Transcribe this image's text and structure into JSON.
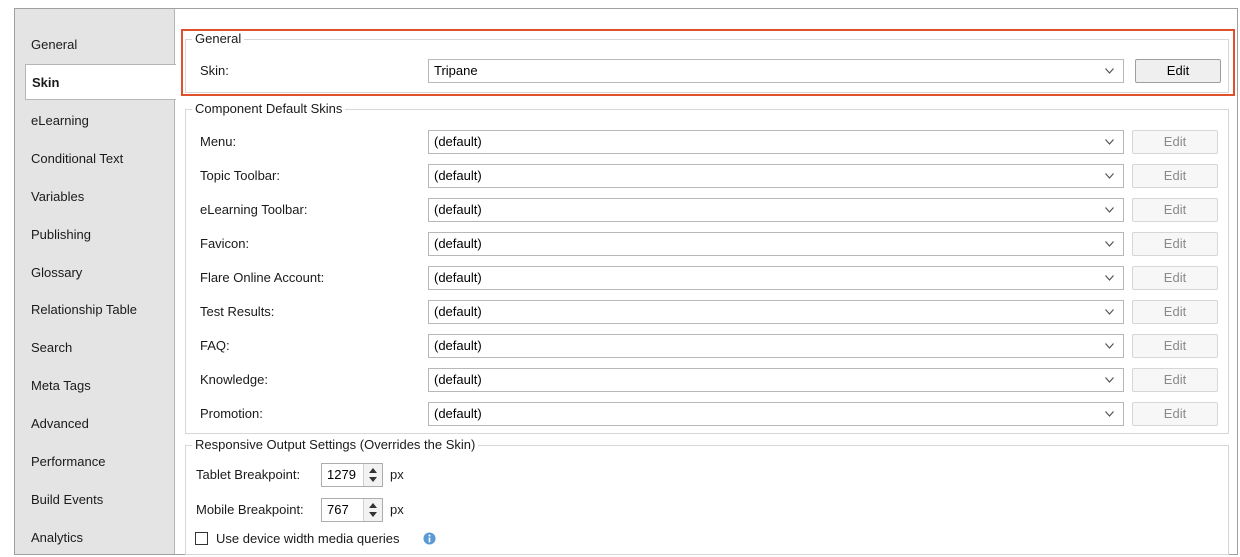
{
  "sidebar": {
    "items": [
      {
        "label": "General",
        "active": false
      },
      {
        "label": "Skin",
        "active": true
      },
      {
        "label": "eLearning",
        "active": false
      },
      {
        "label": "Conditional Text",
        "active": false
      },
      {
        "label": "Variables",
        "active": false
      },
      {
        "label": "Publishing",
        "active": false
      },
      {
        "label": "Glossary",
        "active": false
      },
      {
        "label": "Relationship Table",
        "active": false
      },
      {
        "label": "Search",
        "active": false
      },
      {
        "label": "Meta Tags",
        "active": false
      },
      {
        "label": "Advanced",
        "active": false
      },
      {
        "label": "Performance",
        "active": false
      },
      {
        "label": "Build Events",
        "active": false
      },
      {
        "label": "Analytics",
        "active": false
      }
    ]
  },
  "general": {
    "title": "General",
    "skin_label": "Skin:",
    "skin_value": "Tripane",
    "edit_label": "Edit"
  },
  "component": {
    "title": "Component Default Skins",
    "rows": [
      {
        "label": "Menu:",
        "value": "(default)",
        "edit": "Edit"
      },
      {
        "label": "Topic Toolbar:",
        "value": "(default)",
        "edit": "Edit"
      },
      {
        "label": "eLearning Toolbar:",
        "value": "(default)",
        "edit": "Edit"
      },
      {
        "label": "Favicon:",
        "value": "(default)",
        "edit": "Edit"
      },
      {
        "label": "Flare Online Account:",
        "value": "(default)",
        "edit": "Edit"
      },
      {
        "label": "Test Results:",
        "value": "(default)",
        "edit": "Edit"
      },
      {
        "label": "FAQ:",
        "value": "(default)",
        "edit": "Edit"
      },
      {
        "label": "Knowledge:",
        "value": "(default)",
        "edit": "Edit"
      },
      {
        "label": "Promotion:",
        "value": "(default)",
        "edit": "Edit"
      }
    ]
  },
  "responsive": {
    "title": "Responsive Output Settings (Overrides the Skin)",
    "tablet_label": "Tablet Breakpoint:",
    "tablet_value": "1279",
    "mobile_label": "Mobile Breakpoint:",
    "mobile_value": "767",
    "unit": "px",
    "checkbox_label": "Use device width media queries",
    "checkbox_checked": false
  },
  "colors": {
    "highlight": "#e0502a",
    "info": "#5b9bd5"
  }
}
